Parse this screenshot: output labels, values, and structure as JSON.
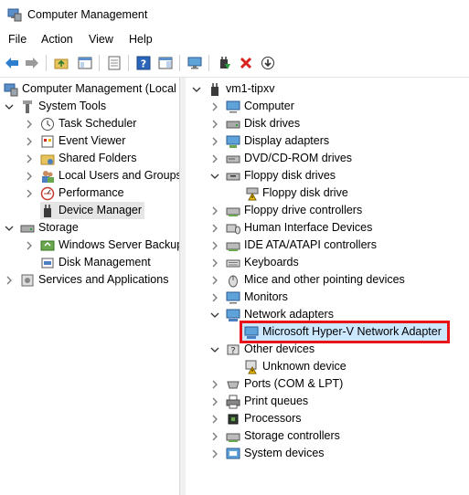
{
  "window": {
    "title": "Computer Management"
  },
  "menu": [
    "File",
    "Action",
    "View",
    "Help"
  ],
  "toolbar": {
    "icons": [
      "back-arrow-icon",
      "forward-arrow-icon",
      "up-folder-icon",
      "show-hide-console-tree-icon",
      "export-list-icon",
      "help-icon",
      "show-action-pane-icon",
      "monitor-icon",
      "update-driver-icon",
      "uninstall-device-icon",
      "scan-hardware-icon"
    ]
  },
  "left_tree": {
    "root": "Computer Management (Local",
    "system_tools": "System Tools",
    "task_scheduler": "Task Scheduler",
    "event_viewer": "Event Viewer",
    "shared_folders": "Shared Folders",
    "local_users": "Local Users and Groups",
    "performance": "Performance",
    "device_manager": "Device Manager",
    "storage": "Storage",
    "wsb": "Windows Server Backup",
    "disk_mgmt": "Disk Management",
    "services": "Services and Applications"
  },
  "device_tree": {
    "root": "vm1-tipxv",
    "computer": "Computer",
    "disk_drives": "Disk drives",
    "display_adapters": "Display adapters",
    "dvd": "DVD/CD-ROM drives",
    "floppy_drives": "Floppy disk drives",
    "floppy_drive": "Floppy disk drive",
    "floppy_controllers": "Floppy drive controllers",
    "hid": "Human Interface Devices",
    "ide": "IDE ATA/ATAPI controllers",
    "keyboards": "Keyboards",
    "mice": "Mice and other pointing devices",
    "monitors": "Monitors",
    "network_adapters": "Network adapters",
    "hyperv_adapter": "Microsoft Hyper-V Network Adapter",
    "other_devices": "Other devices",
    "unknown_device": "Unknown device",
    "ports": "Ports (COM & LPT)",
    "print_queues": "Print queues",
    "processors": "Processors",
    "storage_controllers": "Storage controllers",
    "system_devices": "System devices"
  },
  "colors": {
    "highlight_border": "#e8141a",
    "highlight_fill": "#cce8ff",
    "selected_fill": "#e5e5e5"
  }
}
